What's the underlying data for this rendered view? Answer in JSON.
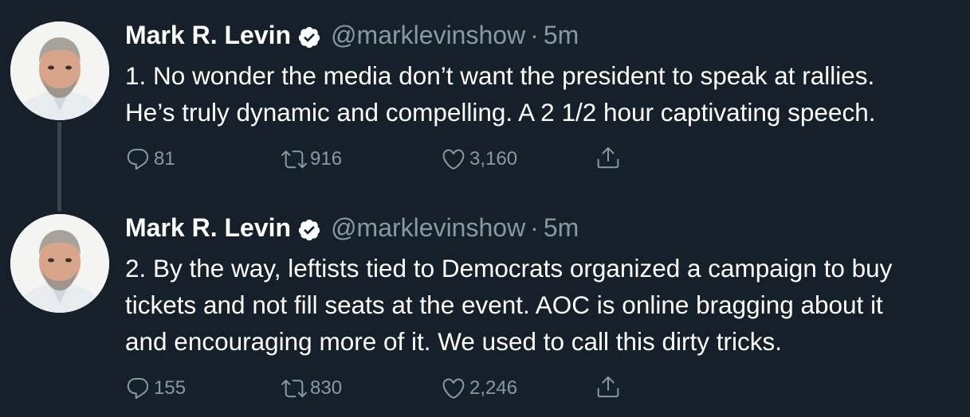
{
  "thread": [
    {
      "author_name": "Mark R. Levin",
      "handle": "@marklevinshow",
      "separator": "·",
      "time": "5m",
      "text_lines": [
        "1. No wonder the media don’t want the president to speak at rallies.",
        "He’s truly dynamic and compelling.  A 2 1/2 hour captivating speech."
      ],
      "replies": "81",
      "retweets": "916",
      "likes": "3,160"
    },
    {
      "author_name": "Mark R. Levin",
      "handle": "@marklevinshow",
      "separator": "·",
      "time": "5m",
      "text_lines": [
        "2. By the way, leftists tied to Democrats organized a campaign to buy",
        "tickets and not fill seats at the event.  AOC is online bragging about it",
        "and encouraging more of it.  We used to call this dirty tricks."
      ],
      "replies": "155",
      "retweets": "830",
      "likes": "2,246"
    }
  ],
  "icons": {
    "reply": "speech-bubble-icon",
    "retweet": "retweet-arrows-icon",
    "like": "heart-icon",
    "share": "share-upload-icon",
    "verified": "verified-badge-icon"
  },
  "colors": {
    "background": "#15202b",
    "text": "#ffffff",
    "secondary_text": "#8899a6",
    "thread_line": "#38444d"
  }
}
